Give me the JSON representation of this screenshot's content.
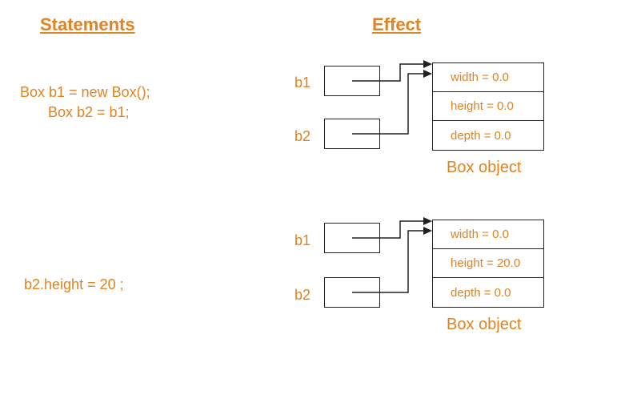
{
  "heading_statements": "Statements",
  "heading_effect": "Effect",
  "row1": {
    "code_line1": "Box b1 = new Box();",
    "code_line2": "Box b2 = b1;",
    "labels": {
      "b1": "b1",
      "b2": "b2"
    },
    "object": {
      "width": "width = 0.0",
      "height": "height = 0.0",
      "depth": "depth = 0.0",
      "caption": "Box object"
    }
  },
  "row2": {
    "code_line1": "b2.height = 20 ;",
    "labels": {
      "b1": "b1",
      "b2": "b2"
    },
    "object": {
      "width": "width = 0.0",
      "height": "height = 20.0",
      "depth": "depth = 0.0",
      "caption": "Box object"
    }
  }
}
